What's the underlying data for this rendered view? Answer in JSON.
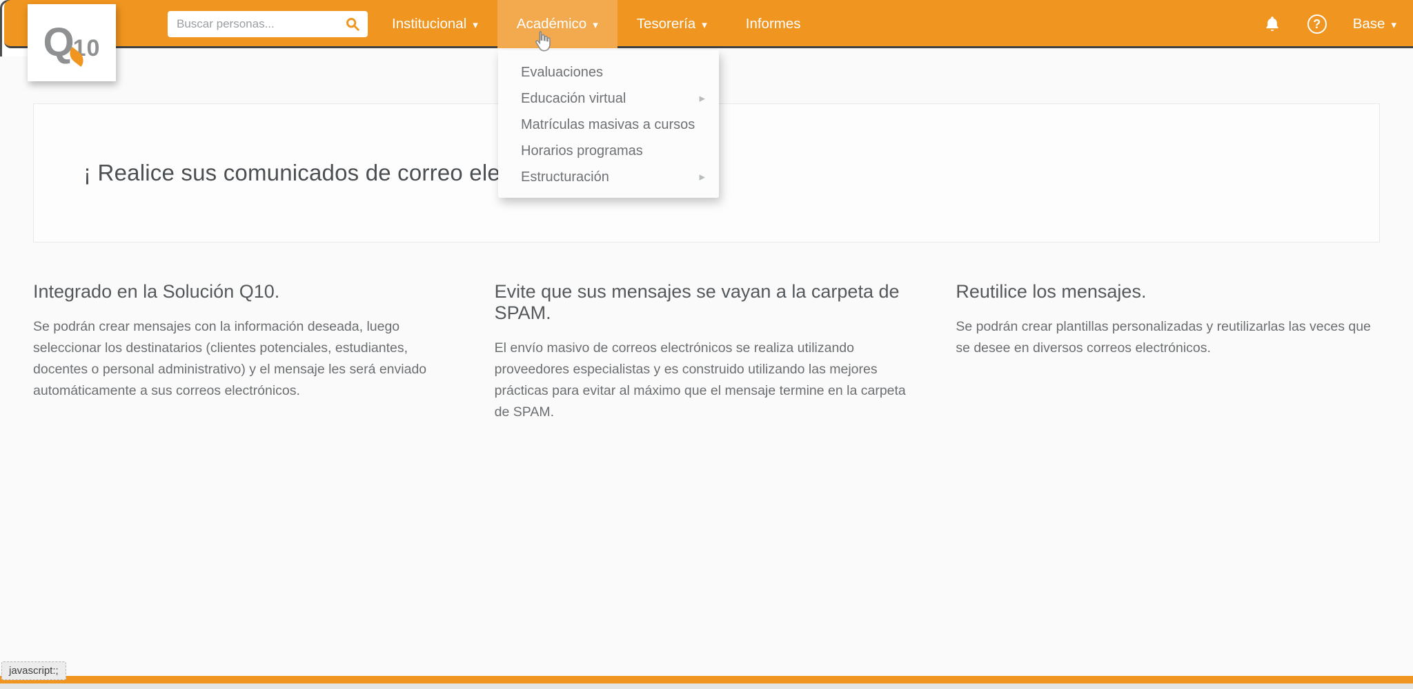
{
  "navbar": {
    "search": {
      "placeholder": "Buscar personas..."
    },
    "items": [
      {
        "label": "Institucional",
        "has_caret": true
      },
      {
        "label": "Académico",
        "has_caret": true,
        "active": true
      },
      {
        "label": "Tesorería",
        "has_caret": true
      },
      {
        "label": "Informes",
        "has_caret": false
      }
    ],
    "user_menu": {
      "label": "Base"
    }
  },
  "logo": {
    "q": "Q",
    "ten": "10"
  },
  "icons": {
    "caret_down": "▾",
    "caret_right": "▸",
    "help": "?"
  },
  "dropdown": {
    "parent": "Académico",
    "items": [
      {
        "label": "Evaluaciones",
        "has_submenu": false
      },
      {
        "label": "Educación virtual",
        "has_submenu": true
      },
      {
        "label": "Matrículas masivas a cursos",
        "has_submenu": false
      },
      {
        "label": "Horarios programas",
        "has_submenu": false
      },
      {
        "label": "Estructuración",
        "has_submenu": true
      }
    ]
  },
  "banner": {
    "heading": "¡ Realice sus comunicados de correo ele"
  },
  "columns": [
    {
      "heading": "Integrado en la Solución Q10.",
      "body": "Se podrán crear mensajes con la información deseada, luego seleccionar los destinatarios (clientes potenciales, estudiantes, docentes o personal administrativo) y el mensaje les será enviado automáticamente a sus correos electrónicos."
    },
    {
      "heading": "Evite que sus mensajes se vayan a la carpeta de SPAM.",
      "body": "El envío masivo de correos electrónicos se realiza utilizando proveedores especialistas y es construido utilizando las mejores prácticas para evitar al máximo que el mensaje termine en la carpeta de SPAM."
    },
    {
      "heading": "Reutilice los mensajes.",
      "body": "Se podrán crear plantillas personalizadas y reutilizarlas las veces que se desee en diversos correos electrónicos."
    }
  ],
  "statusbar": {
    "text": "javascript:;"
  },
  "colors": {
    "accent": "#f0951f",
    "accent_active": "#f3aa4e",
    "nav_border": "#3f4144",
    "heading_text": "#4b4f52",
    "body_text": "#6b6e71"
  }
}
